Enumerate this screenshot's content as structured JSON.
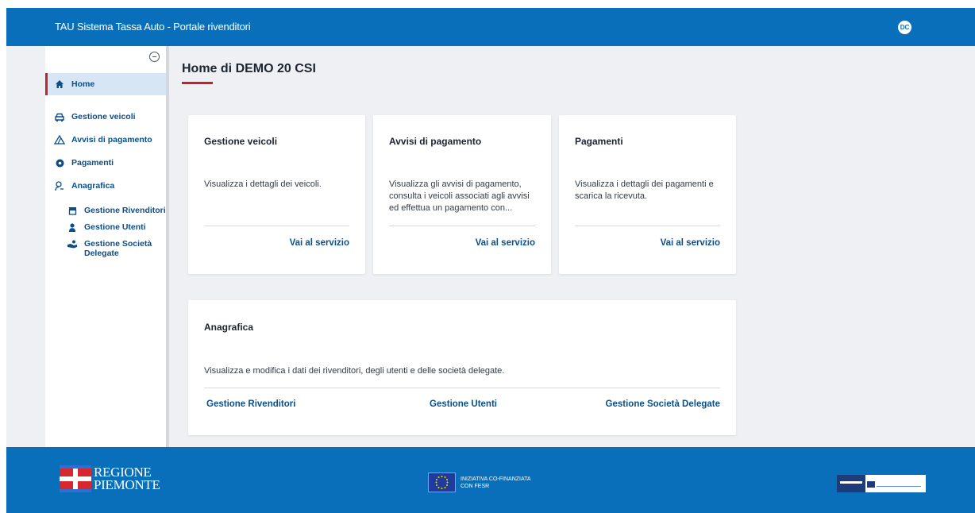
{
  "app": {
    "title": "TAU Sistema Tassa Auto - Portale rivenditori",
    "avatar_initials": "DC"
  },
  "sidebar": {
    "items": [
      {
        "label": "Home",
        "icon": "home-icon"
      },
      {
        "label": "Gestione veicoli",
        "icon": "car-icon"
      },
      {
        "label": "Avvisi di pagamento",
        "icon": "warning-icon"
      },
      {
        "label": "Pagamenti",
        "icon": "payment-icon"
      },
      {
        "label": "Anagrafica",
        "icon": "user-outline-icon"
      }
    ],
    "subitems": [
      {
        "label": "Gestione Rivenditori",
        "icon": "store-icon"
      },
      {
        "label": "Gestione Utenti",
        "icon": "user-icon"
      },
      {
        "label": "Gestione Società Delegate",
        "icon": "handshake-icon"
      }
    ]
  },
  "main": {
    "title": "Home di DEMO 20 CSI",
    "cards": [
      {
        "title": "Gestione veicoli",
        "description": "Visualizza i dettagli dei veicoli.",
        "link": "Vai al servizio"
      },
      {
        "title": "Avvisi di pagamento",
        "description": "Visualizza gli avvisi di pagamento, consulta i veicoli associati agli avvisi ed effettua un pagamento con...",
        "link": "Vai al servizio"
      },
      {
        "title": "Pagamenti",
        "description": "Visualizza i dettagli dei pagamenti e scarica la ricevuta.",
        "link": "Vai al servizio"
      }
    ],
    "anagrafica": {
      "title": "Anagrafica",
      "description": "Visualizza e modifica i dati dei rivenditori, degli utenti e delle società delegate.",
      "links": [
        "Gestione Rivenditori",
        "Gestione Utenti",
        "Gestione Società Delegate"
      ]
    }
  },
  "footer": {
    "regione_line1": "REGIONE",
    "regione_line2": "PIEMONTE",
    "eu_line1": "INIZIATIVA CO-FINANZIATA",
    "eu_line2": "CON FESR"
  },
  "colors": {
    "header": "#0a6fba",
    "accent": "#c0232b",
    "link": "#0b4f8a"
  }
}
